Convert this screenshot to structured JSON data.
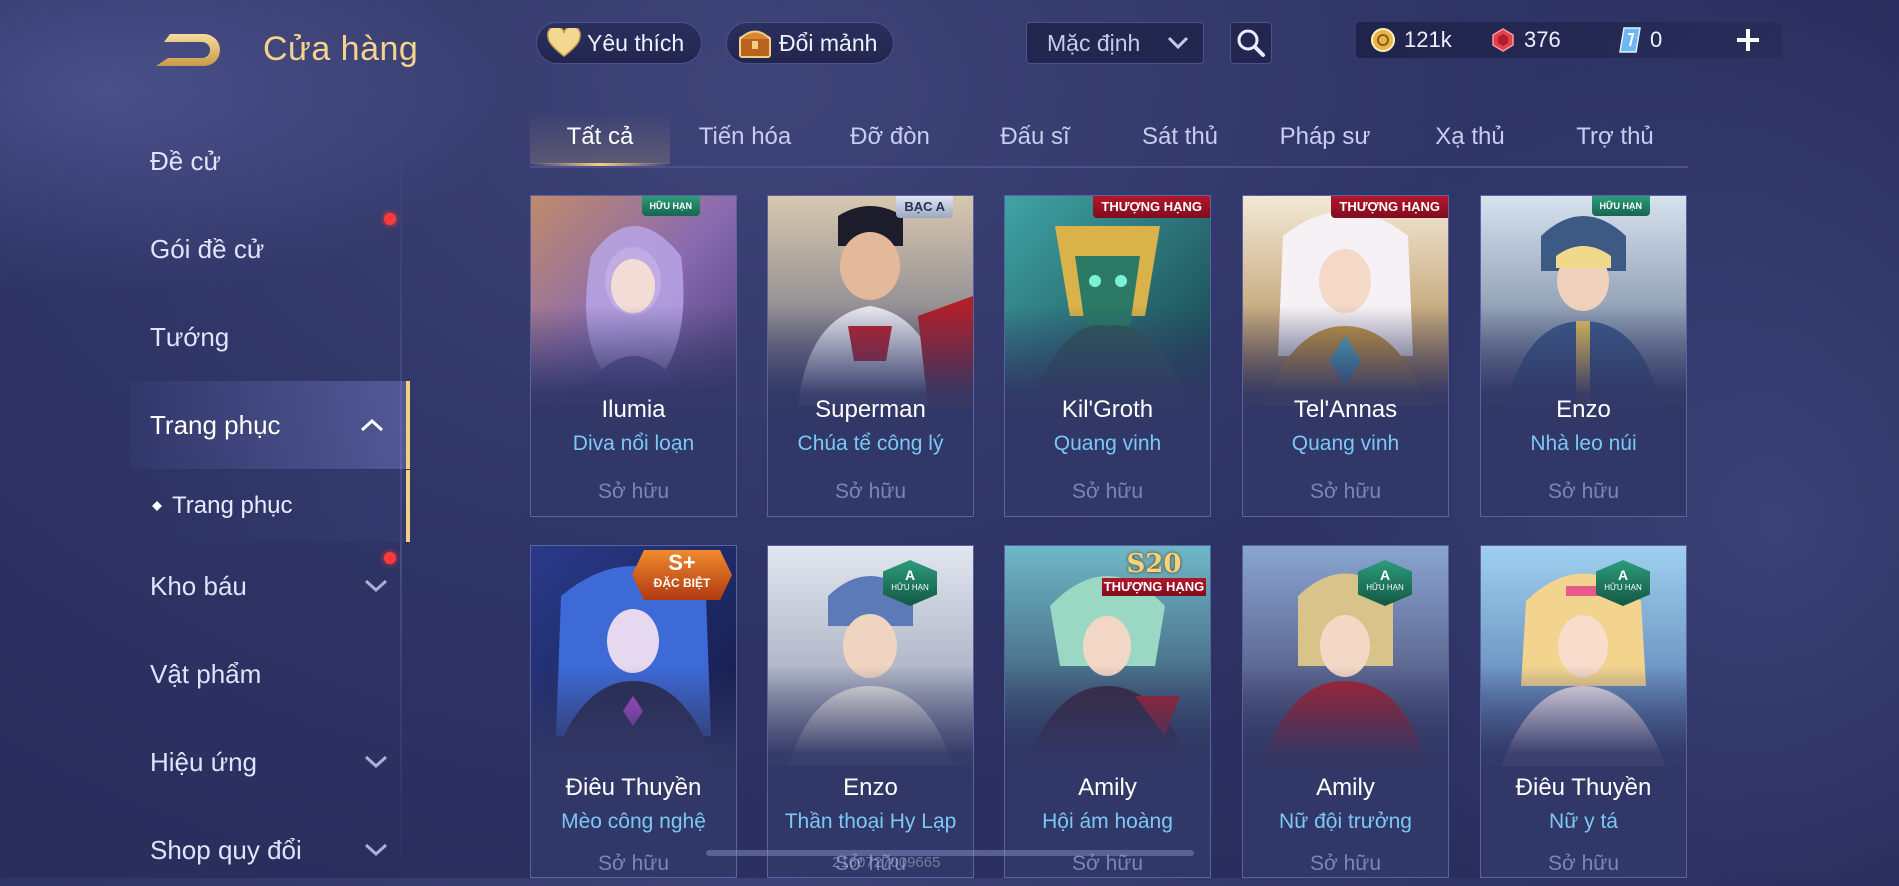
{
  "header": {
    "title": "Cửa hàng",
    "favorite_label": "Yêu thích",
    "fragments_label": "Đổi mảnh",
    "sort_value": "Mặc định",
    "currencies": {
      "gold": "121k",
      "ruby": "376",
      "ticket": "0"
    }
  },
  "sidebar": {
    "items": [
      {
        "label": "Đề cử"
      },
      {
        "label": "Gói đề cử"
      },
      {
        "label": "Tướng"
      },
      {
        "label": "Trang phục"
      },
      {
        "label": "Kho báu"
      },
      {
        "label": "Vật phẩm"
      },
      {
        "label": "Hiệu ứng"
      },
      {
        "label": "Shop quy đổi"
      }
    ],
    "sub_item": "Trang phục"
  },
  "tabs": [
    {
      "label": "Tất cả"
    },
    {
      "label": "Tiến hóa"
    },
    {
      "label": "Đỡ đòn"
    },
    {
      "label": "Đấu sĩ"
    },
    {
      "label": "Sát thủ"
    },
    {
      "label": "Pháp sư"
    },
    {
      "label": "Xạ thủ"
    },
    {
      "label": "Trợ thủ"
    }
  ],
  "cards": [
    {
      "hero": "Ilumia",
      "skin": "Diva nổi loạn",
      "status": "Sở hữu",
      "badge": "HỮU HẠN"
    },
    {
      "hero": "Superman",
      "skin": "Chúa tể công lý",
      "status": "Sở hữu",
      "badge": "BẠC A"
    },
    {
      "hero": "Kil'Groth",
      "skin": "Quang vinh",
      "status": "Sở hữu",
      "badge": "THƯỢNG HẠNG"
    },
    {
      "hero": "Tel'Annas",
      "skin": "Quang vinh",
      "status": "Sở hữu",
      "badge": "THƯỢNG HẠNG"
    },
    {
      "hero": "Enzo",
      "skin": "Nhà leo núi",
      "status": "Sở hữu",
      "badge": "HỮU HẠN"
    },
    {
      "hero": "Điêu Thuyền",
      "skin": "Mèo công nghệ",
      "status": "Sở hữu",
      "badge_tier": "S+",
      "badge": "ĐẶC BIỆT"
    },
    {
      "hero": "Enzo",
      "skin": "Thần thoại Hy Lạp",
      "status": "Sở hữu",
      "badge_tier": "A",
      "badge": "HỮU HẠN"
    },
    {
      "hero": "Amily",
      "skin": "Hội ám hoàng",
      "status": "Sở hữu",
      "badge_tier": "S20",
      "badge": "THƯỢNG HẠNG"
    },
    {
      "hero": "Amily",
      "skin": "Nữ đội trưởng",
      "status": "Sở hữu",
      "badge_tier": "A",
      "badge": "HỮU HẠN"
    },
    {
      "hero": "Điêu Thuyền",
      "skin": "Nữ y tá",
      "status": "Sở hữu",
      "badge_tier": "A",
      "badge": "HỮU HẠN"
    }
  ],
  "watermark": "2160727009665",
  "icons": {
    "back": "back-arrow-icon",
    "favorite": "heart-icon",
    "fragments": "chest-icon",
    "sort": "chevron-down-icon",
    "search": "search-icon",
    "gold": "gold-coin-icon",
    "ruby": "ruby-gem-icon",
    "ticket": "voucher-icon",
    "add": "plus-icon"
  },
  "colors": {
    "accent_gold": "#f2cf83",
    "skin_name_blue": "#7cc8f4",
    "owned_text": "#7d84b8",
    "notification_red": "#ff3a3a",
    "background": "#2f3466"
  }
}
